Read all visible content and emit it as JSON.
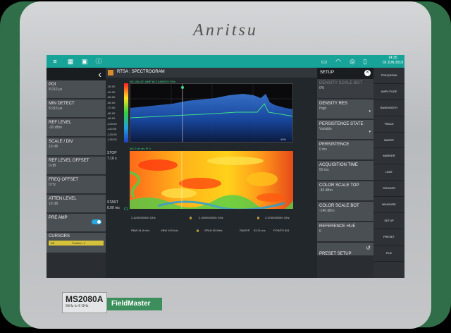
{
  "device": {
    "brand": "Anritsu",
    "model": "MS2080A",
    "model_sub": "9kHz to 6 GHz",
    "series": "FieldMaster"
  },
  "topbar": {
    "icons": [
      "menu-icon",
      "grid-icon",
      "camera-icon",
      "info-icon",
      "screen-icon",
      "wifi-icon",
      "gps-icon",
      "battery-icon"
    ],
    "time": "14:35",
    "date": "03 JUN 2019"
  },
  "left_panel": {
    "items": [
      {
        "label": "POI",
        "value": "8.910 µs"
      },
      {
        "label": "MIN DETECT",
        "value": "8.910 µs"
      },
      {
        "label": "REF LEVEL",
        "value": "-30 dBm"
      },
      {
        "label": "SCALE / DIV",
        "value": "10 dB"
      },
      {
        "label": "REF LEVEL OFFSET",
        "value": "0 dB"
      },
      {
        "label": "FREQ OFFSET",
        "value": "0 Hz"
      },
      {
        "label": "ATTEN LEVEL",
        "value": "10 dB"
      }
    ],
    "pre_amp": "PRE AMP",
    "cursors": "CURSORS",
    "cursor_bar": {
      "c1": "C1",
      "pos": "Position: 0"
    }
  },
  "center": {
    "title": "RTSA : SPECTROGRAM",
    "trace1": "W1   VALUE: AMP @ 2.4480470 GHz",
    "trace2": "W1   0.00 ms  ▼ 0",
    "y_ticks": [
      "-30.00",
      "-40.00",
      "-50.00",
      "-60.00",
      "-70.00",
      "-80.00",
      "-90.00",
      "-100.00",
      "-110.00",
      "-120.00",
      "-130.00"
    ],
    "stop_label": "STOP",
    "stop_value": "7.16 s",
    "start_label": "START",
    "start_value": "0.00 ms",
    "c1": "C1",
    "pct": "49%",
    "freq_left": "2.4250000000 GHz",
    "freq_mid": "2.4500000000 GHz",
    "freq_right": "2.4750000000 GHz",
    "rbw": "RBW 61.8 kHz",
    "vbw": "VBW 100 kHz",
    "span": "SPAN 50 MHz",
    "sweep": "SWEEP",
    "sweep_time": "53.31 ms",
    "points": "POINTS 501"
  },
  "setup": {
    "header": "SETUP",
    "items": [
      {
        "label": "DENSITY SCALE BOT",
        "value": "0%",
        "dim": true
      },
      {
        "label": "DENSITY RES",
        "value": "High",
        "dd": true
      },
      {
        "label": "PERSISTENCE STATE",
        "value": "Variable",
        "dd": true
      },
      {
        "label": "PERSISTENCE",
        "value": "0 ms"
      },
      {
        "label": "ACQUISITION TIME",
        "value": "50 ms"
      },
      {
        "label": "COLOR SCALE TOP",
        "value": "-30 dBm"
      },
      {
        "label": "COLOR SCALE BOT",
        "value": "-140 dBm"
      },
      {
        "label": "REFERENCE HUE",
        "value": "0"
      }
    ],
    "preset": "PRESET SETUP"
  },
  "right_menu": [
    "FREQ/SPAN",
    "AMPLITUDE",
    "BANDWIDTH",
    "TRACE",
    "SWEEP",
    "MARKER",
    "LIMIT",
    "TRIGGER",
    "MEASURE",
    "SETUP",
    "PRESET",
    "FILE"
  ],
  "colors": {
    "accent": "#18a398",
    "bumper": "#2f6e48",
    "spectrum": "#2f8ad6",
    "cursor_bar": "#d6c23a"
  }
}
